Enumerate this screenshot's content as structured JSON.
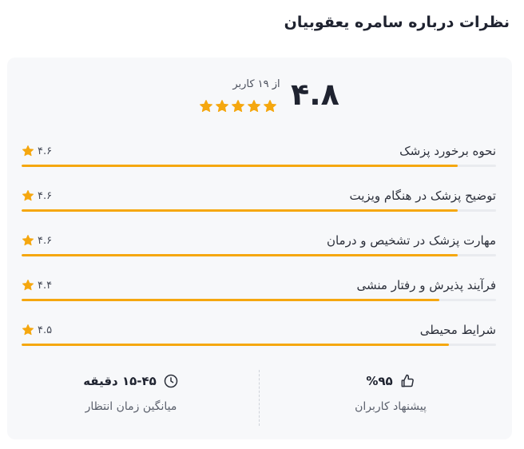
{
  "page": {
    "title": "نظرات درباره سامره یعقوبیان"
  },
  "summary": {
    "score": "۴.۸",
    "users_text": "از ۱۹ کاربر",
    "stars": 5
  },
  "criteria": [
    {
      "label": "نحوه برخورد پزشک",
      "score": "۴.۶",
      "value": 4.6
    },
    {
      "label": "توضیح پزشک در هنگام ویزیت",
      "score": "۴.۶",
      "value": 4.6
    },
    {
      "label": "مهارت پزشک در تشخیص و درمان",
      "score": "۴.۶",
      "value": 4.6
    },
    {
      "label": "فرآیند پذیرش و رفتار منشی",
      "score": "۴.۴",
      "value": 4.4
    },
    {
      "label": "شرایط محیطی",
      "score": "۴.۵",
      "value": 4.5
    }
  ],
  "stats": {
    "recommend": {
      "value": "%۹۵",
      "label": "پیشنهاد کاربران",
      "icon": "thumbs-up-icon"
    },
    "wait_time": {
      "value": "۱۵-۴۵ دقیقه",
      "label": "میانگین زمان انتظار",
      "icon": "clock-icon"
    }
  },
  "colors": {
    "accent": "#f5a70f",
    "star": "#f5a70f",
    "track": "#e9ebef"
  },
  "max_score": 5
}
